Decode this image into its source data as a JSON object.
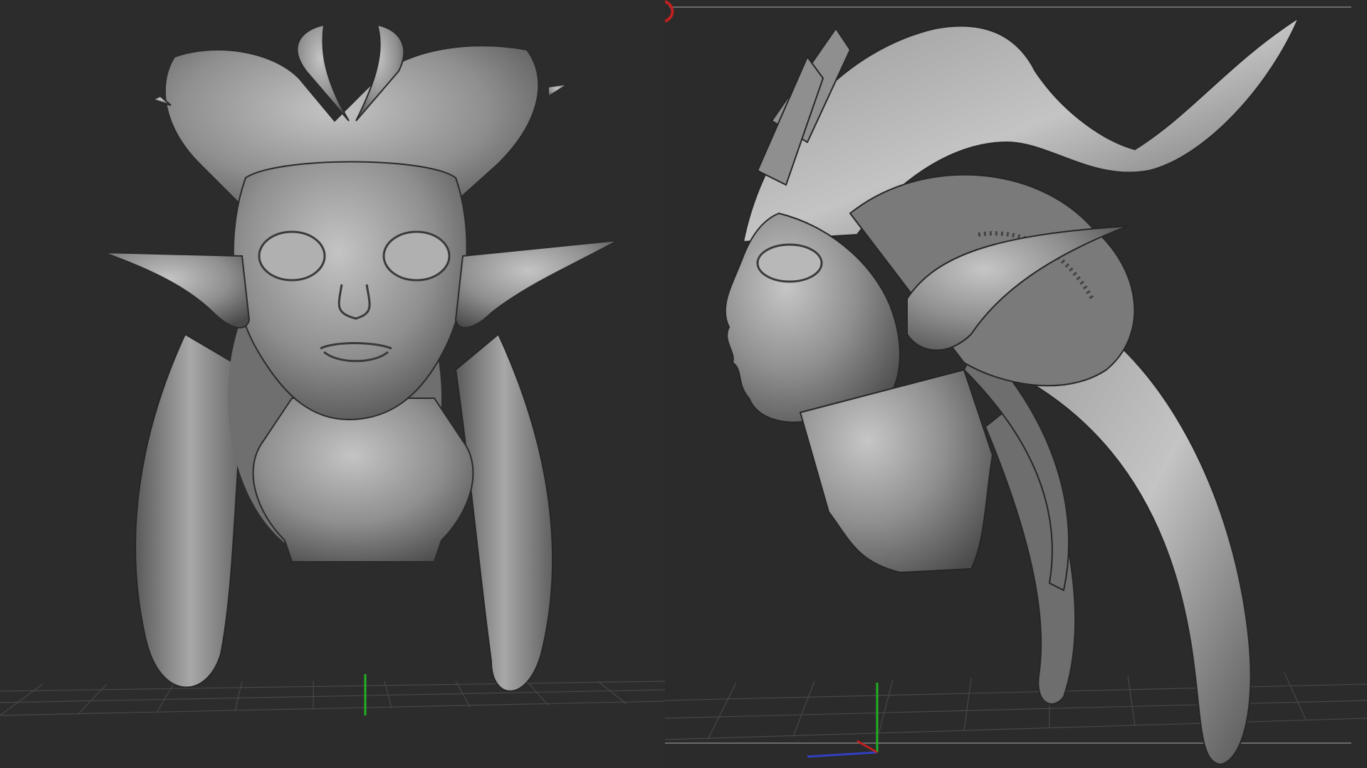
{
  "app": {
    "layout": "split-view",
    "viewport_count": 2
  },
  "viewports": [
    {
      "view": "front",
      "subject": "alien-creature-head-sculpt",
      "show_floor_grid": true,
      "show_axis_gizmo": true
    },
    {
      "view": "side",
      "subject": "alien-creature-head-sculpt",
      "show_floor_grid": true,
      "show_axis_gizmo": true,
      "show_frame_guides": true
    }
  ],
  "colors": {
    "background": "#2b2b2b",
    "clay": "#8a8a8a",
    "clay_light": "#bdbdbd",
    "clay_dark": "#4d4d4d",
    "grid": "#4a4a4a",
    "axis_x": "#c02020",
    "axis_y": "#20b020",
    "axis_z": "#3040c0"
  }
}
